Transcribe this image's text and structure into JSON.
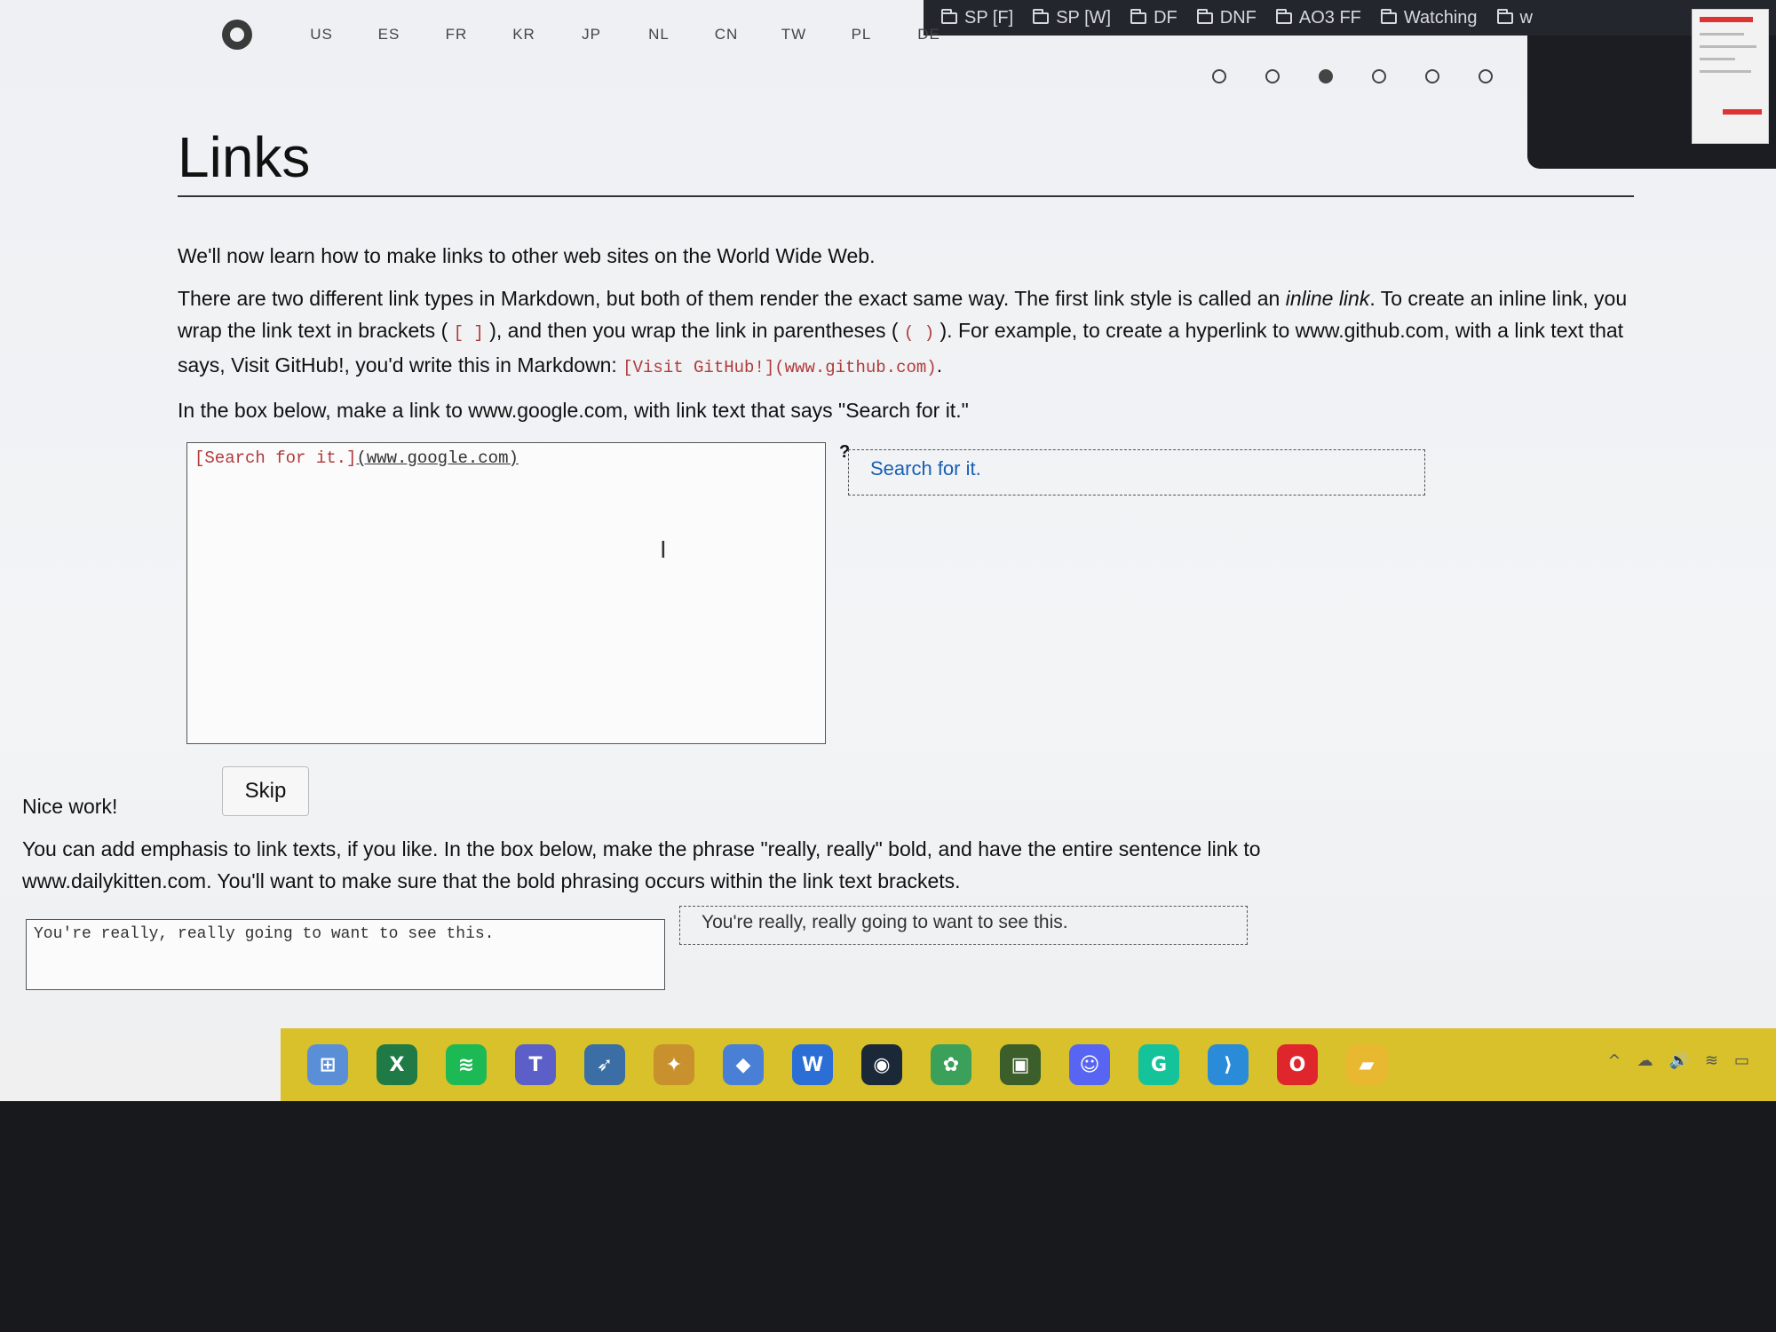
{
  "bookmarks": [
    "SP [F]",
    "SP [W]",
    "DF",
    "DNF",
    "AO3 FF",
    "Watching",
    "w"
  ],
  "nav": {
    "languages": [
      "US",
      "ES",
      "FR",
      "KR",
      "JP",
      "NL",
      "CN",
      "TW",
      "PL",
      "DE"
    ],
    "progress": {
      "total": 6,
      "active_index": 2
    }
  },
  "page": {
    "title": "Links",
    "intro": "We'll now learn how to make links to other web sites on the World Wide Web.",
    "para2": {
      "t1": "There are two different link types in Markdown, but both of them render the exact same way. The first link style is called an ",
      "em": "inline link",
      "t2": ". To create an inline link, you wrap the link text in brackets ( ",
      "code1": "[ ]",
      "t3": " ), and then you wrap the link in parentheses ( ",
      "code2": "( )",
      "t4": " ). For example, to create a hyperlink to www.github.com, with a link text that says, Visit GitHub!, you'd write this in Markdown: ",
      "code3": "[Visit GitHub!](www.github.com)",
      "t5": "."
    },
    "instruction1": "In the box below, make a link to www.google.com, with link text that says \"Search for it.\"",
    "editor1": {
      "text_part": "[Search for it.]",
      "link_part": "(www.google.com)"
    },
    "help_label": "?",
    "preview1": "Search for it.",
    "skip_label": "Skip",
    "nice_work": "Nice work!",
    "instruction2": "You can add emphasis to link texts, if you like. In the box below, make the phrase \"really, really\" bold, and have the entire sentence link to www.dailykitten.com. You'll want to make sure that the bold phrasing occurs within the link text brackets.",
    "editor2": "You're really, really going to want to see this.",
    "preview2": "You're really, really going to want to see this."
  },
  "taskbar": {
    "icons": [
      {
        "name": "start-icon",
        "glyph": "⊞",
        "color": "#5a8fd8"
      },
      {
        "name": "excel-icon",
        "glyph": "X",
        "color": "#1f7a45"
      },
      {
        "name": "spotify-icon",
        "glyph": "≋",
        "color": "#1db954"
      },
      {
        "name": "teams-icon",
        "glyph": "T",
        "color": "#5b5fc7"
      },
      {
        "name": "cursor-app-icon",
        "glyph": "➶",
        "color": "#3a6ea5"
      },
      {
        "name": "game-icon",
        "glyph": "✦",
        "color": "#c9912e"
      },
      {
        "name": "photos-icon",
        "glyph": "◆",
        "color": "#4a7fd6"
      },
      {
        "name": "word-icon",
        "glyph": "W",
        "color": "#2b6fd6"
      },
      {
        "name": "steam-icon",
        "glyph": "◉",
        "color": "#1b2838"
      },
      {
        "name": "feather-app-icon",
        "glyph": "✿",
        "color": "#3aa05a"
      },
      {
        "name": "minecraft-icon",
        "glyph": "▣",
        "color": "#3b5e2b"
      },
      {
        "name": "discord-icon",
        "glyph": "☺",
        "color": "#5865f2"
      },
      {
        "name": "grammarly-icon",
        "glyph": "G",
        "color": "#15c39a"
      },
      {
        "name": "vscode-icon",
        "glyph": "⟩",
        "color": "#2a8bd8"
      },
      {
        "name": "opera-icon",
        "glyph": "O",
        "color": "#e0262d"
      },
      {
        "name": "file-explorer-icon",
        "glyph": "▰",
        "color": "#e8b830"
      }
    ],
    "tray": [
      "^",
      "☁",
      "🔊",
      "≋",
      "▭"
    ]
  }
}
